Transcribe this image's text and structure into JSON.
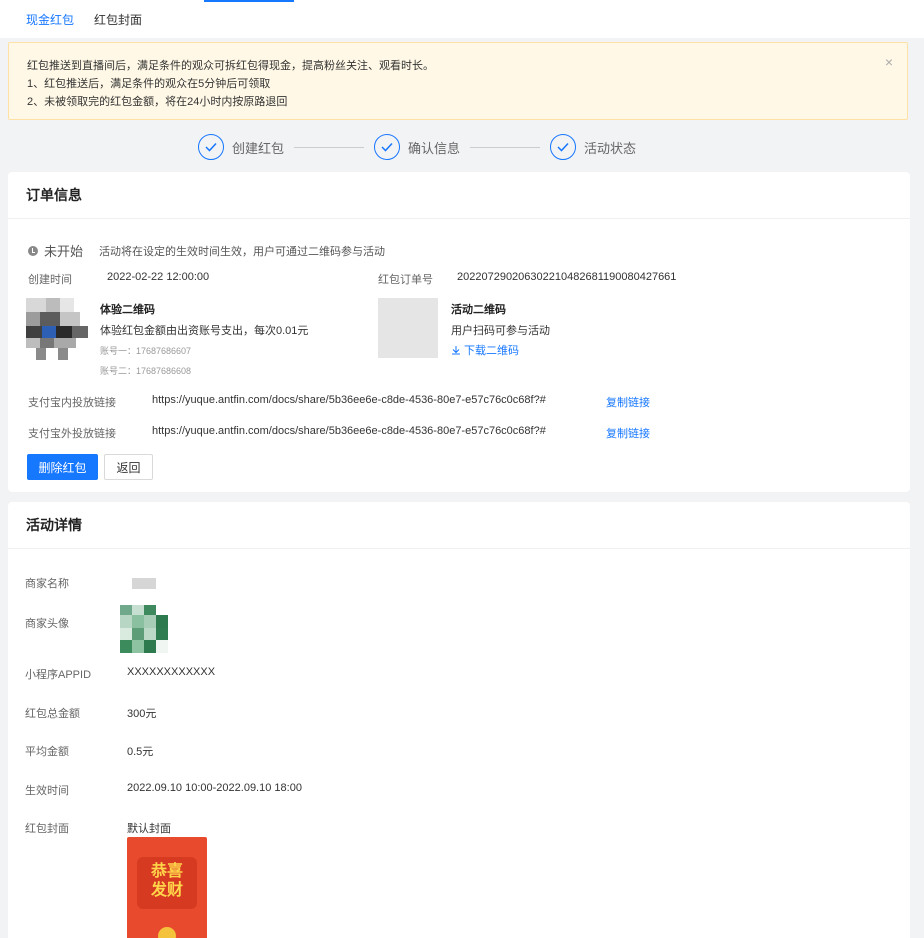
{
  "tabs": [
    {
      "label": "现金红包",
      "active": true
    },
    {
      "label": "红包封面",
      "active": false
    }
  ],
  "alert": {
    "line1": "红包推送到直播间后，满足条件的观众可拆红包得现金，提高粉丝关注、观看时长。",
    "line2": "1、红包推送后，满足条件的观众在5分钟后可领取",
    "line3": "2、未被领取完的红包金额，将在24小时内按原路退回",
    "close": "×"
  },
  "steps": [
    {
      "label": "创建红包"
    },
    {
      "label": "确认信息"
    },
    {
      "label": "活动状态"
    }
  ],
  "order": {
    "title": "订单信息",
    "status_label": "未开始",
    "status_desc": "活动将在设定的生效时间生效，用户可通过二维码参与活动",
    "created_label": "创建时间",
    "created_value": "2022-02-22 12:00:00",
    "order_no_label": "红包订单号",
    "order_no_value": "2022072902063022104826811900804276​61",
    "trial_qr_title": "体验二维码",
    "trial_qr_desc": "体验红包金额由出资账号支出，每次0.01元",
    "account1": "账号一：17687686607",
    "account2": "账号二：17687686608",
    "activity_qr_title": "活动二维码",
    "activity_qr_desc": "用户扫码可参与活动",
    "download_qr": "下载二维码",
    "inner_link_label": "支付宝内投放链接",
    "inner_link_value": "https://yuque.antfin.com/docs/share/5b36ee6e-c8de-4536-80e7-e57c76c0c68f?#",
    "outer_link_label": "支付宝外投放链接",
    "outer_link_value": "https://yuque.antfin.com/docs/share/5b36ee6e-c8de-4536-80e7-e57c76c0c68f?#",
    "copy_link": "复制链接",
    "delete_button": "删除红包",
    "back_button": "返回"
  },
  "activity": {
    "title": "活动详情",
    "merchant_name_label": "商家名称",
    "merchant_avatar_label": "商家头像",
    "appid_label": "小程序APPID",
    "appid_value": "XXXXXXXXXXXX",
    "total_label": "红包总金额",
    "total_value": "300元",
    "avg_label": "平均金额",
    "avg_value": "0.5元",
    "time_label": "生效时间",
    "time_value": "2022.09.10 10:00-2022.09.10 18:00",
    "cover_label": "红包封面",
    "cover_value": "默认封面",
    "cover_text1": "恭喜",
    "cover_text2": "发财"
  },
  "colors": {
    "accent": "#1677ff",
    "warning_bg": "#fff8e6",
    "cover_red": "#e84a2e"
  }
}
